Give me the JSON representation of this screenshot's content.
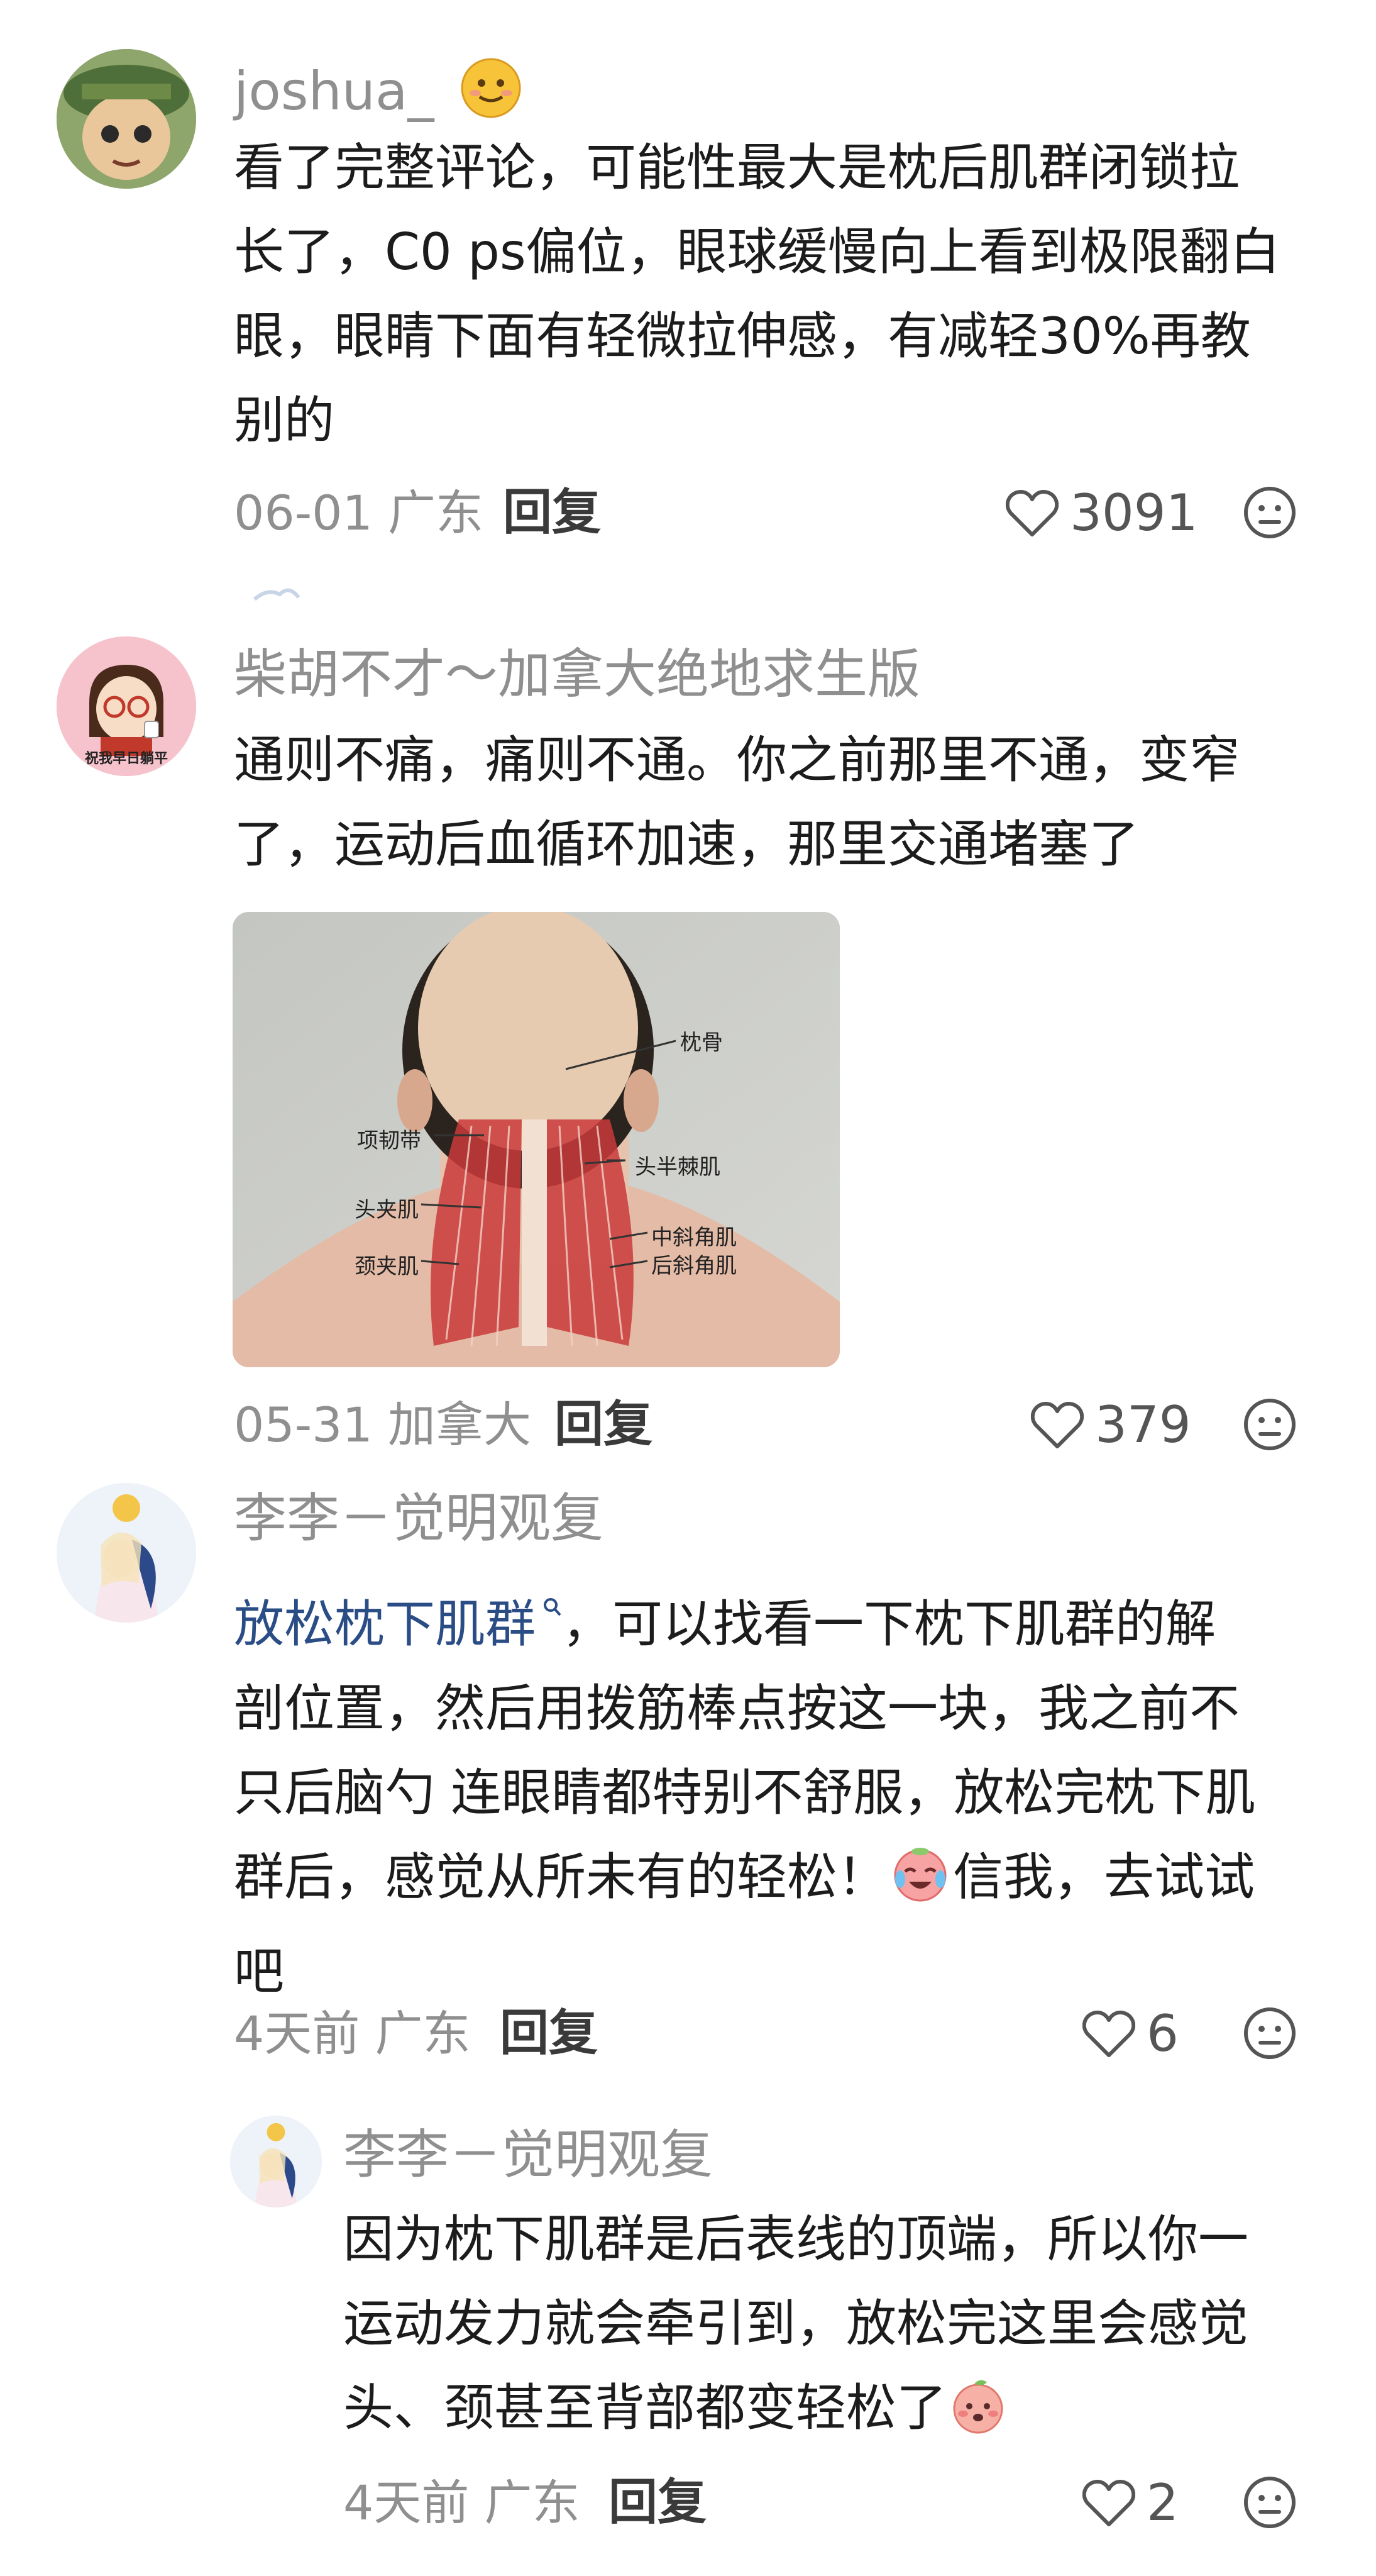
{
  "comments": [
    {
      "username": "joshua_",
      "lines": [
        "看了完整评论，可能性最大是枕后肌群闭锁拉",
        "长了，C0 ps偏位，眼球缓慢向上看到极限翻白",
        "眼，眼睛下面有轻微拉伸感，有减轻30%再教",
        "别的"
      ],
      "meta": "06-01 广东",
      "reply": "回复",
      "likes": "3091"
    },
    {
      "username": "柴胡不才～加拿大绝地求生版",
      "avatar_caption": "祝我早日躺平",
      "lines": [
        "通则不痛，痛则不通。你之前那里不通，变窄",
        "了，运动后血循环加速，那里交通堵塞了"
      ],
      "image_labels": [
        "枕骨",
        "项韧带",
        "头半棘肌",
        "头夹肌",
        "中斜角肌",
        "颈夹肌",
        "后斜角肌"
      ],
      "meta": "05-31 加拿大",
      "reply": "回复",
      "likes": "379"
    },
    {
      "username": "李李－觉明观复",
      "link_text": "放松枕下肌群",
      "first_line_rest": "，可以找看一下枕下肌群的解",
      "lines": [
        "剖位置，然后用拨筋棒点按这一块，我之前不",
        "只后脑勺 连眼睛都特别不舒服，放松完枕下肌",
        "群后，感觉从所未有的轻松！"
      ],
      "line4_tail": "信我，去试试",
      "line5": "吧",
      "meta": "4天前 广东",
      "reply": "回复",
      "likes": "6"
    },
    {
      "username": "李李－觉明观复",
      "lines": [
        "因为枕下肌群是后表线的顶端，所以你一",
        "运动发力就会牵引到，放松完这里会感觉"
      ],
      "line3": "头、颈甚至背部都变轻松了",
      "meta": "4天前 广东",
      "reply": "回复",
      "likes": "2"
    }
  ],
  "icons": {
    "like": "heart-outline-icon",
    "react": "neutral-face-icon",
    "topic": "search-icon"
  },
  "colors": {
    "link": "#2b4d86",
    "meta": "#8f8f8f",
    "text": "#1c1c1c"
  }
}
